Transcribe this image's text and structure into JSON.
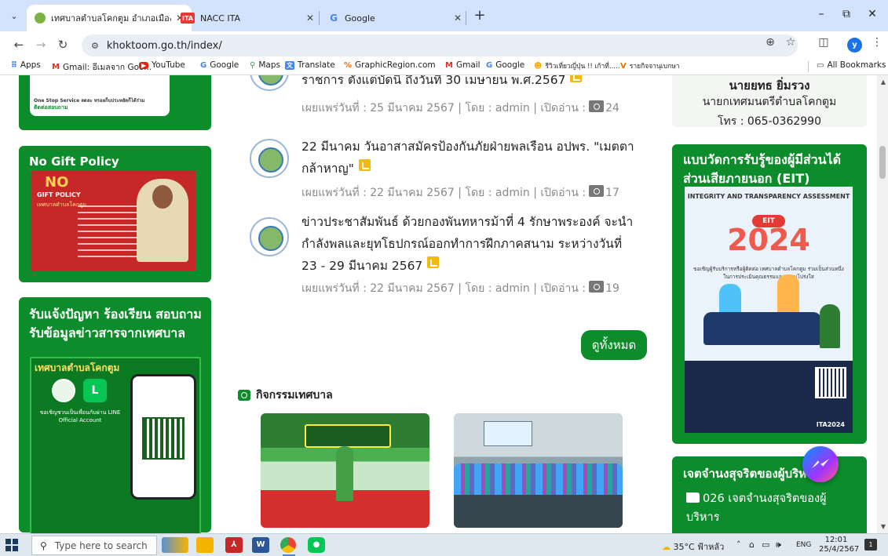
{
  "browser": {
    "tabs": [
      {
        "title": "เทศบาลตำบลโคกตูม อำเภอเมืองลพบุ",
        "active": true
      },
      {
        "title": "NACC ITA",
        "active": false
      },
      {
        "title": "Google",
        "active": false
      }
    ],
    "tab_favicons": {
      "ita": "ITA",
      "google": "G"
    },
    "url": "khoktoom.go.th/index/",
    "profile_initial": "y",
    "window_controls": {
      "minimize": "–",
      "maximize": "⧉",
      "close": "✕"
    },
    "bookmarks": [
      {
        "label": "Apps",
        "icon": "apps-grid-icon"
      },
      {
        "label": "Gmail: อีเมลจาก Goo...",
        "icon": "gmail-icon"
      },
      {
        "label": "YouTube",
        "icon": "youtube-icon"
      },
      {
        "label": "Google",
        "icon": "google-icon"
      },
      {
        "label": "Maps",
        "icon": "maps-icon"
      },
      {
        "label": "Translate",
        "icon": "translate-icon"
      },
      {
        "label": "GraphicRegion.com",
        "icon": "graphicregion-icon"
      },
      {
        "label": "Gmail",
        "icon": "gmail-icon"
      },
      {
        "label": "Google",
        "icon": "google-icon"
      },
      {
        "label": "รีวิวเที่ยวญี่ปุ่น !! เก้าที่.....",
        "icon": "emoji-icon"
      },
      {
        "label": "รายกิจจานุเบกษา",
        "icon": "v-icon"
      }
    ],
    "all_bookmarks": "All Bookmarks"
  },
  "left": {
    "banner1_lines": [
      "One Stop Service ลดละ ทรอยก็บประหยัดก็ได้ร่วม",
      "ติดต่อสอบถาม"
    ],
    "no_gift": {
      "heading": "No Gift Policy",
      "poster_no": "NO",
      "poster_gift": "GIFT POLICY",
      "poster_town": "เทศบาลตำบลโคกตูม"
    },
    "report": {
      "heading": "รับแจ้งปัญหา ร้องเรียน สอบถาม รับข้อมูลข่าวสารจากเทศบาล",
      "poster_title": "เทศบาลตำบลโคกตูม",
      "poster_line": "L",
      "poster_text": "ขอเชิญชวนเป็นเพื่อนกับผ่าน LINE Official Account"
    }
  },
  "news": [
    {
      "title": "ราชการ ตั้งแต่บัดนี้ ถึงวันที่ 30 เมษายน พ.ศ.2567",
      "meta": "เผยแพร่วันที่ : 25 มีนาคม 2567 | โดย : admin | เปิดอ่าน :",
      "views": "24"
    },
    {
      "title": "22 มีนาคม วันอาสาสมัครป้องกันภัยฝ่ายพลเรือน อปพร. \"เมตตา กล้าหาญ\"",
      "meta": "เผยแพร่วันที่ : 22 มีนาคม 2567 | โดย : admin | เปิดอ่าน :",
      "views": "17"
    },
    {
      "title": "ข่าวประชาสัมพันธ์ ด้วยกองพันทหารม้าที่ 4 รักษาพระองค์ จะนำกำลังพลและยุทโธปกรณ์ออกทำการฝึกภาคสนาม ระหว่างวันที่ 23 - 29 มีนาคม 2567",
      "meta": "เผยแพร่วันที่ : 22 มีนาคม 2567 | โดย : admin | เปิดอ่าน :",
      "views": "19"
    }
  ],
  "view_all": "ดูทั้งหมด",
  "activities": {
    "heading": "กิจกรรมเทศบาล"
  },
  "right": {
    "mayor": {
      "name": "นายยุทธ ยิ่มรวง",
      "position": "นายกเทศมนตรีตำบลโคกตูม",
      "tel": "โทร : 065-0362990"
    },
    "eit": {
      "heading": "แบบวัดการรับรู้ของผู้มีส่วนได้ส่วนเสียภายนอก (EIT)",
      "poster_arc": "INTEGRITY AND TRANSPARENCY ASSESSMENT",
      "poster_label": "EIT",
      "poster_year": "2024",
      "poster_sub": "ขอเชิญผู้รับบริการหรือผู้ติดต่อ เทศบาลตำบลโคกตูม ร่วมเป็นส่วนหนึ่งในการประเมินคุณธรรมและความโปร่งใส",
      "poster_footer": "ITA2024"
    },
    "intent": {
      "heading": "เจตจำนงสุจริตของผู้บริหาร",
      "item": "026 เจตจำนงสุจริตของผู้บริหาร"
    }
  },
  "taskbar": {
    "search_placeholder": "Type here to search",
    "weather": "35°C ฟ้าหลัว",
    "lang": "ENG",
    "time": "12:01",
    "date": "25/4/2567",
    "notifications": "1"
  }
}
